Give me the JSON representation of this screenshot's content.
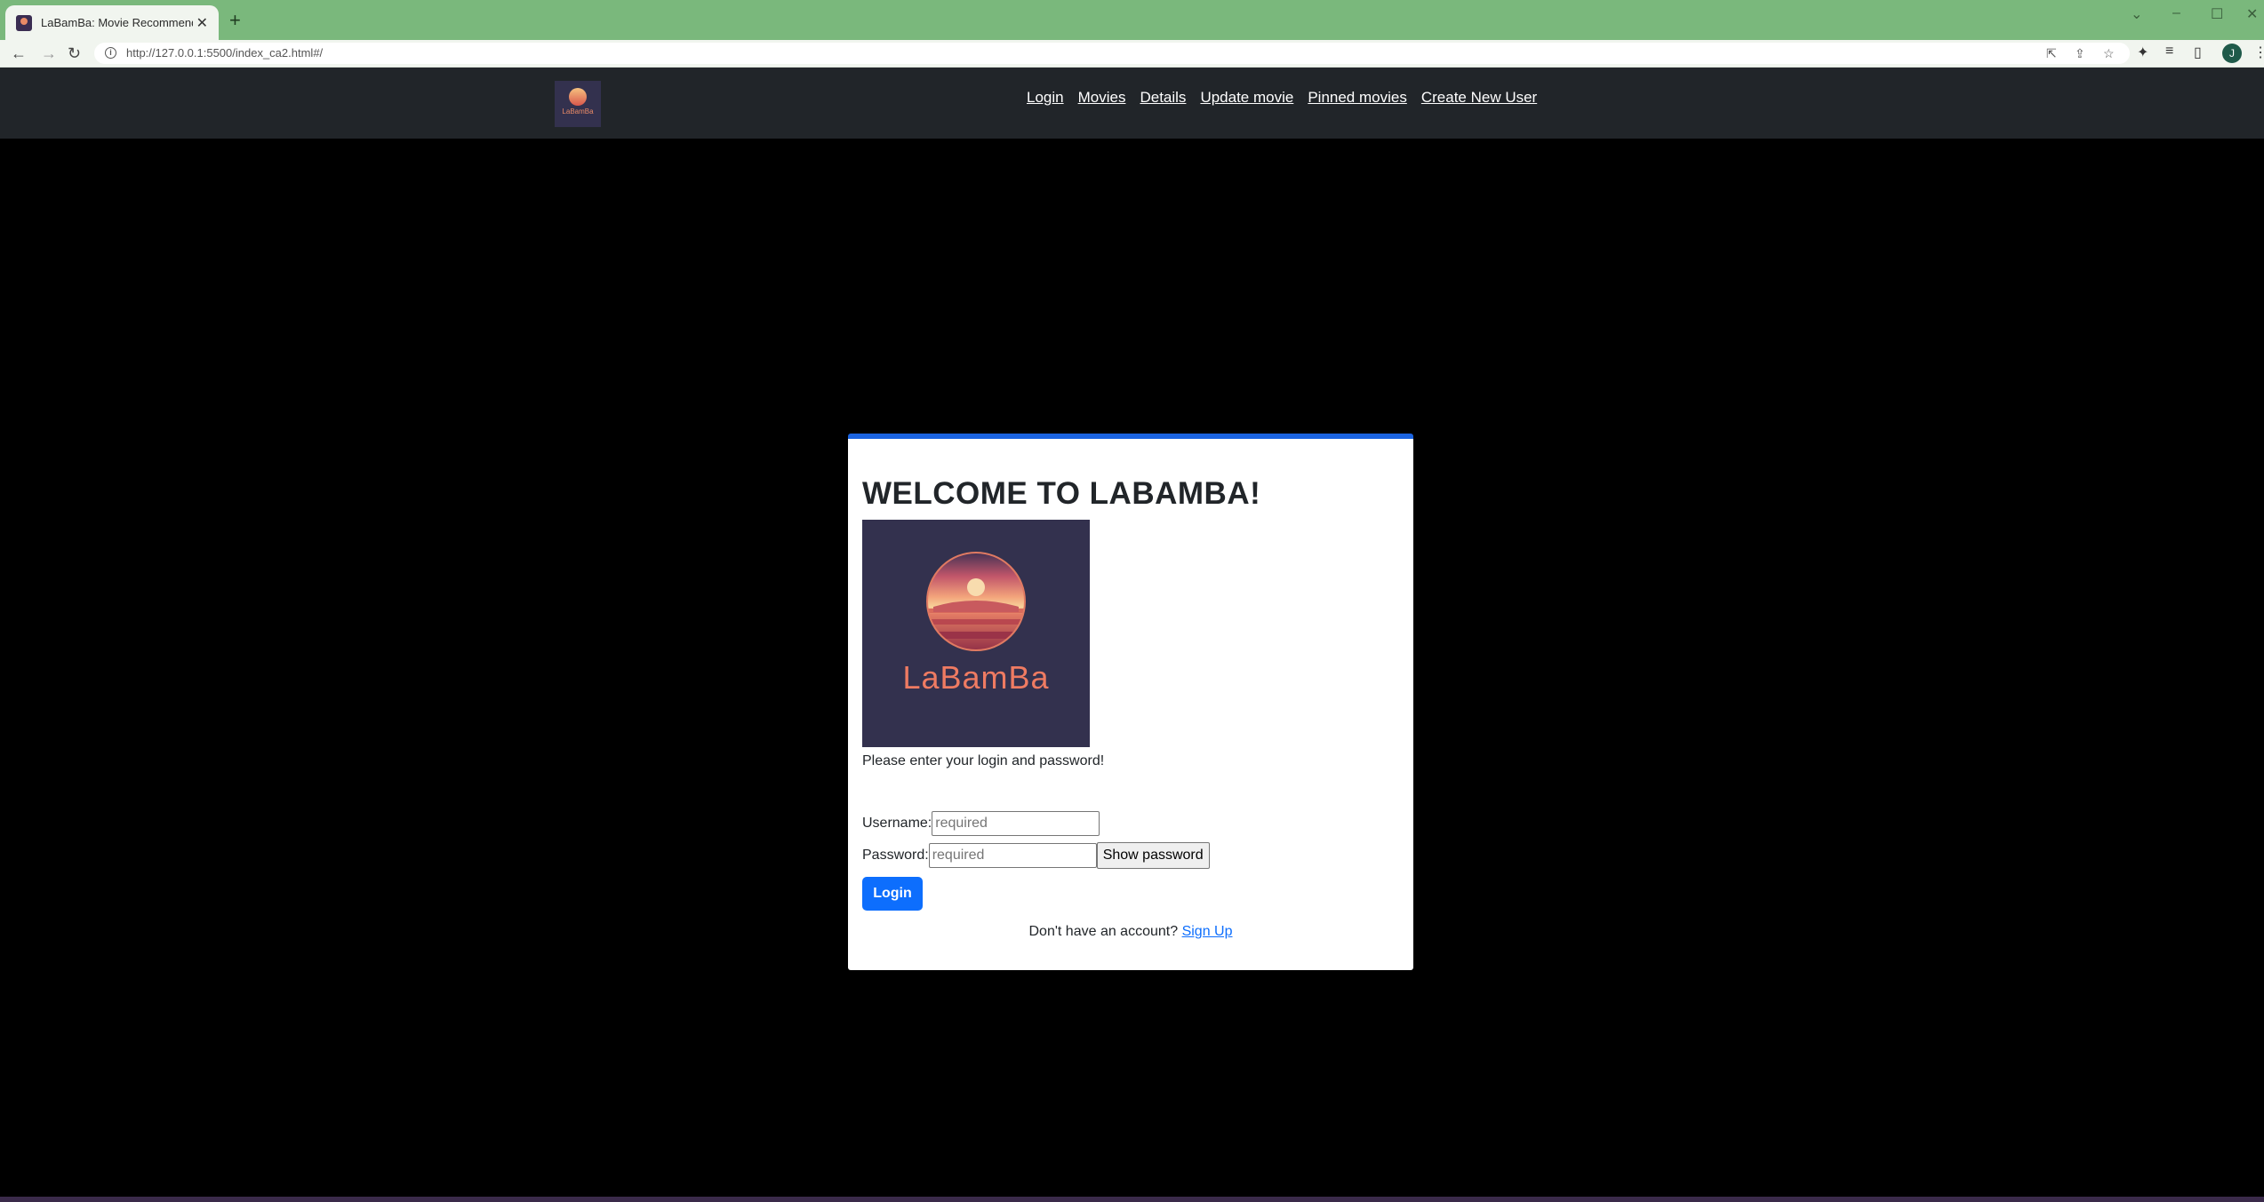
{
  "browser": {
    "tab_title": "LaBamBa: Movie Recommender",
    "tab_close": "✕",
    "new_tab": "+",
    "url": "http://127.0.0.1:5500/index_ca2.html#/",
    "profile_initial": "J"
  },
  "nav": {
    "links": [
      "Login",
      "Movies",
      "Details",
      "Update movie",
      "Pinned movies",
      "Create New User"
    ],
    "logo_text": "LaBamBa"
  },
  "login": {
    "heading": "WELCOME TO LABAMBA!",
    "logo_text": "LaBamBa",
    "prompt": "Please enter your login and password!",
    "username_label": "Username:",
    "username_placeholder": "required",
    "password_label": "Password:",
    "password_placeholder": "required",
    "show_password": "Show password",
    "login_button": "Login",
    "signup_prompt": "Don't have an account?",
    "signup_link": "Sign Up"
  },
  "colors": {
    "tabstrip": "#7ab87c",
    "navbar": "#212529",
    "accent": "#0d6efd",
    "logo_bg": "#33314e",
    "logo_text": "#ef7b62"
  }
}
